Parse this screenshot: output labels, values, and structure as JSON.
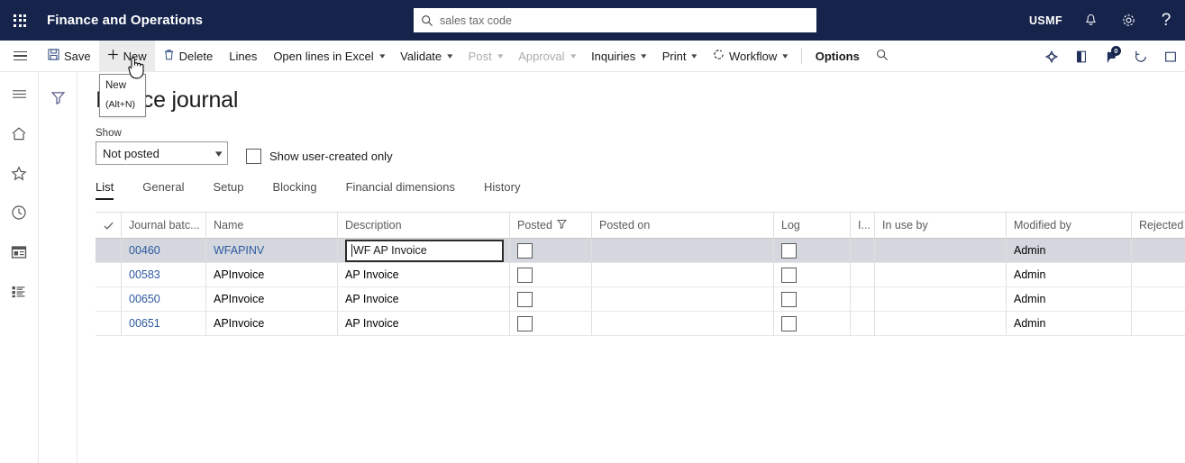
{
  "topbar": {
    "waffle_icon": "app-launcher-icon",
    "app_title": "Finance and Operations",
    "search": {
      "icon": "search-icon",
      "value": "sales tax code"
    },
    "company": "USMF",
    "notifications_icon": "bell-icon",
    "settings_icon": "gear-icon",
    "help_icon": "question-icon",
    "help_label": "?"
  },
  "actionpane": {
    "menu_icon": "hamburger-icon",
    "buttons": [
      {
        "label": "Save",
        "icon": "save-icon",
        "state": "normal",
        "dropdown": false
      },
      {
        "label": "New",
        "icon": "plus-icon",
        "state": "hovered",
        "dropdown": false
      },
      {
        "label": "Delete",
        "icon": "trash-icon",
        "state": "normal",
        "dropdown": false
      },
      {
        "label": "Lines",
        "icon": "",
        "state": "normal",
        "dropdown": false
      },
      {
        "label": "Open lines in Excel",
        "icon": "",
        "state": "normal",
        "dropdown": true
      },
      {
        "label": "Validate",
        "icon": "",
        "state": "normal",
        "dropdown": true
      },
      {
        "label": "Post",
        "icon": "",
        "state": "disabled",
        "dropdown": true
      },
      {
        "label": "Approval",
        "icon": "",
        "state": "disabled",
        "dropdown": true
      },
      {
        "label": "Inquiries",
        "icon": "",
        "state": "normal",
        "dropdown": true
      },
      {
        "label": "Print",
        "icon": "",
        "state": "normal",
        "dropdown": true
      },
      {
        "label": "Workflow",
        "icon": "workflow-icon",
        "state": "normal",
        "dropdown": true
      },
      {
        "label": "Options",
        "icon": "",
        "state": "bold",
        "dropdown": false
      }
    ],
    "search_icon": "search-icon",
    "right_icons": [
      {
        "name": "personalize-icon",
        "badge": ""
      },
      {
        "name": "attachments-icon",
        "badge": ""
      },
      {
        "name": "annotations-icon",
        "badge": "0"
      },
      {
        "name": "refresh-icon",
        "badge": ""
      },
      {
        "name": "expand-icon",
        "badge": ""
      }
    ]
  },
  "tooltip": {
    "title": "New",
    "shortcut": "(Alt+N)"
  },
  "leftnav": {
    "items": [
      {
        "icon": "hamburger-icon",
        "name": "nav-menu"
      },
      {
        "icon": "home-icon",
        "name": "nav-home"
      },
      {
        "icon": "star-icon",
        "name": "nav-favorites"
      },
      {
        "icon": "clock-icon",
        "name": "nav-recent"
      },
      {
        "icon": "workspace-icon",
        "name": "nav-workspaces"
      },
      {
        "icon": "modules-icon",
        "name": "nav-modules"
      }
    ]
  },
  "filterpane": {
    "icon": "filter-icon"
  },
  "page": {
    "title": "Invoice journal",
    "show_label": "Show",
    "show_value": "Not posted",
    "user_created_label": "Show user-created only",
    "user_created_checked": false
  },
  "tabs": [
    {
      "label": "List",
      "active": true
    },
    {
      "label": "General",
      "active": false
    },
    {
      "label": "Setup",
      "active": false
    },
    {
      "label": "Blocking",
      "active": false
    },
    {
      "label": "Financial dimensions",
      "active": false
    },
    {
      "label": "History",
      "active": false
    }
  ],
  "grid": {
    "columns": [
      {
        "key": "check",
        "label": "",
        "sorted": "",
        "filtered": false
      },
      {
        "key": "batch",
        "label": "Journal batc...",
        "sorted": "asc",
        "filtered": false
      },
      {
        "key": "name",
        "label": "Name",
        "sorted": "",
        "filtered": false
      },
      {
        "key": "desc",
        "label": "Description",
        "sorted": "",
        "filtered": false
      },
      {
        "key": "posted",
        "label": "Posted",
        "sorted": "",
        "filtered": true
      },
      {
        "key": "poston",
        "label": "Posted on",
        "sorted": "",
        "filtered": false
      },
      {
        "key": "log",
        "label": "Log",
        "sorted": "",
        "filtered": false
      },
      {
        "key": "i",
        "label": "I...",
        "sorted": "",
        "filtered": false
      },
      {
        "key": "inuse",
        "label": "In use by",
        "sorted": "",
        "filtered": false
      },
      {
        "key": "mod",
        "label": "Modified by",
        "sorted": "",
        "filtered": false
      },
      {
        "key": "rej",
        "label": "Rejected by",
        "sorted": "",
        "filtered": false
      }
    ],
    "rows": [
      {
        "batch": "00460",
        "name": "WFAPINV",
        "desc": "WF AP Invoice",
        "posted": false,
        "poston": "",
        "log": false,
        "i": "",
        "inuse": "",
        "mod": "Admin",
        "rej": "",
        "selected": true,
        "editing": true
      },
      {
        "batch": "00583",
        "name": "APInvoice",
        "desc": "AP Invoice",
        "posted": false,
        "poston": "",
        "log": false,
        "i": "",
        "inuse": "",
        "mod": "Admin",
        "rej": "",
        "selected": false,
        "editing": false
      },
      {
        "batch": "00650",
        "name": "APInvoice",
        "desc": "AP Invoice",
        "posted": false,
        "poston": "",
        "log": false,
        "i": "",
        "inuse": "",
        "mod": "Admin",
        "rej": "",
        "selected": false,
        "editing": false
      },
      {
        "batch": "00651",
        "name": "APInvoice",
        "desc": "AP Invoice",
        "posted": false,
        "poston": "",
        "log": false,
        "i": "",
        "inuse": "",
        "mod": "Admin",
        "rej": "",
        "selected": false,
        "editing": false
      }
    ]
  },
  "colors": {
    "nav_bg": "#16244c",
    "link": "#2c5aa0",
    "selected_row": "#d4d7de",
    "hover": "#ebebeb"
  }
}
